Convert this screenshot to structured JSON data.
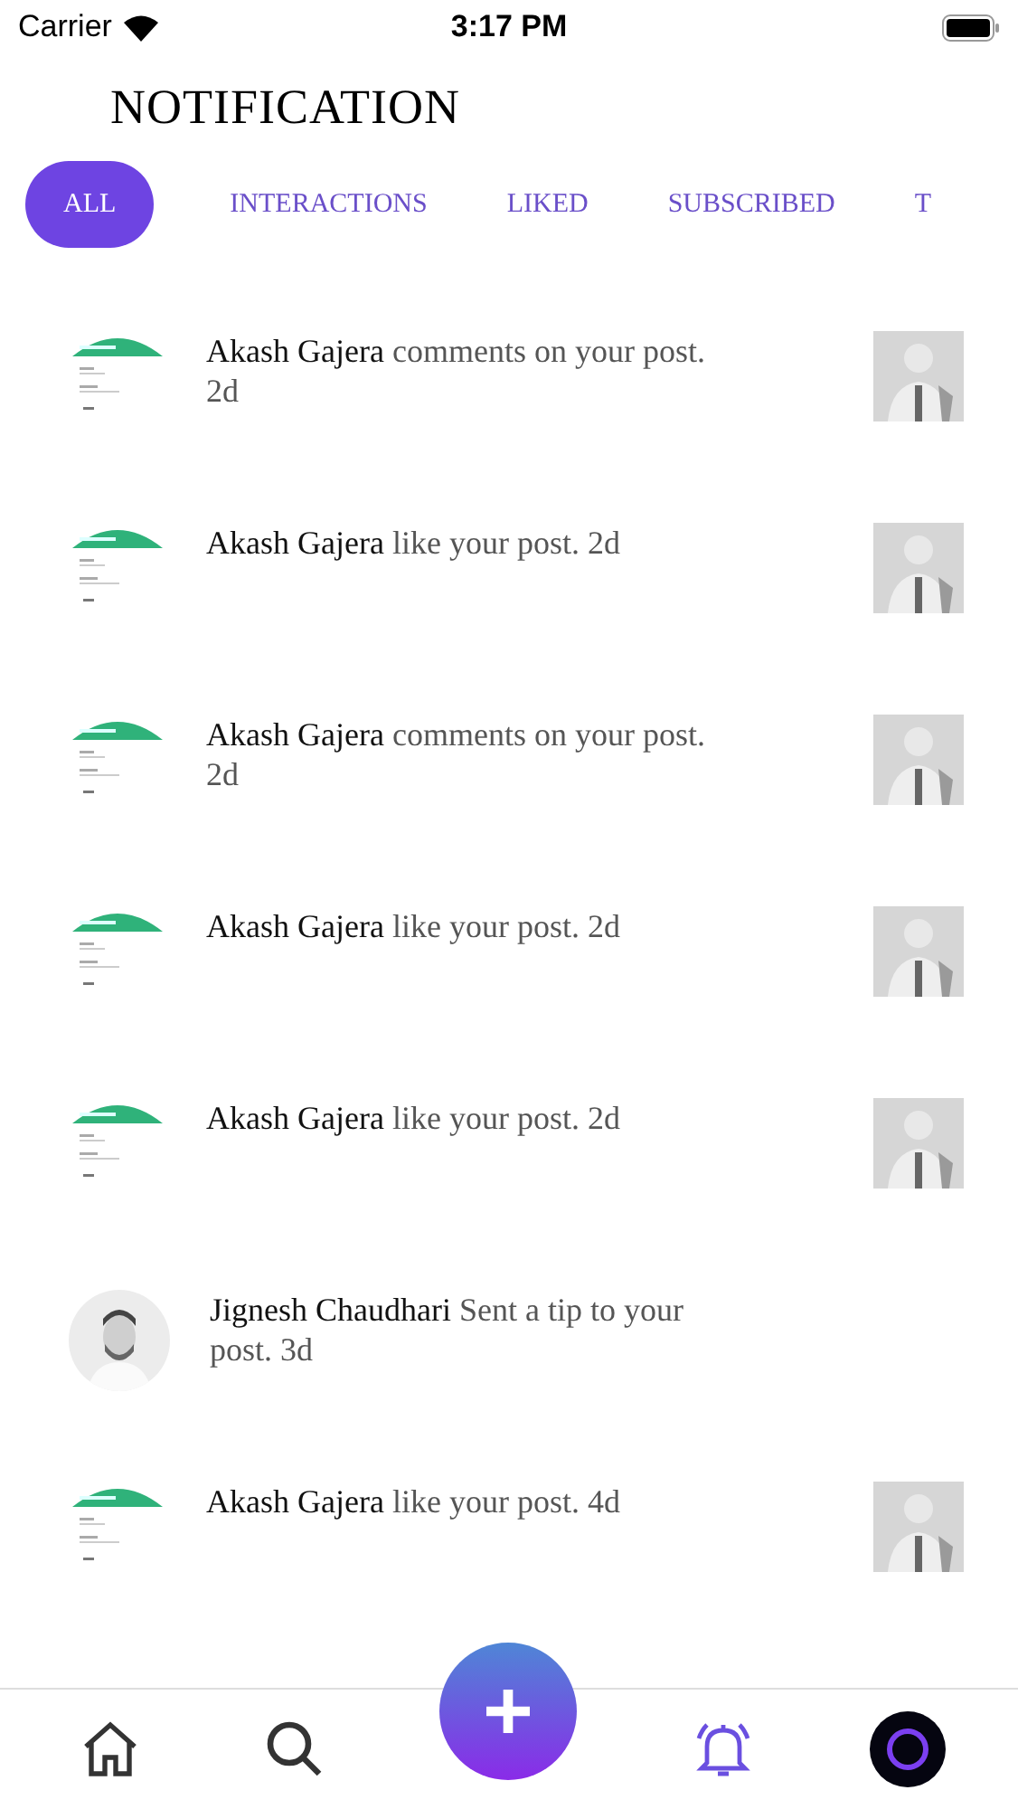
{
  "status_bar": {
    "carrier": "Carrier",
    "time": "3:17 PM"
  },
  "title": "NOTIFICATION",
  "tabs": [
    {
      "label": "ALL",
      "selected": true
    },
    {
      "label": "INTERACTIONS",
      "selected": false
    },
    {
      "label": "LIKED",
      "selected": false
    },
    {
      "label": "SUBSCRIBED",
      "selected": false
    },
    {
      "label": "T",
      "selected": false
    }
  ],
  "notifications": [
    {
      "kind": "post",
      "name": "Akash Gajera",
      "action": "comments on your post. 2d"
    },
    {
      "kind": "post",
      "name": "Akash Gajera",
      "action": "like your post. 2d"
    },
    {
      "kind": "post",
      "name": "Akash Gajera",
      "action": "comments on your post. 2d"
    },
    {
      "kind": "post",
      "name": "Akash Gajera",
      "action": "like your post. 2d"
    },
    {
      "kind": "post",
      "name": "Akash Gajera",
      "action": "like your post. 2d"
    },
    {
      "kind": "user",
      "name": "Jignesh Chaudhari",
      "action": "Sent a tip to your post. 3d"
    },
    {
      "kind": "post",
      "name": "Akash Gajera",
      "action": "like your post. 4d"
    }
  ],
  "bottom_nav": [
    {
      "kind": "home",
      "selected": false
    },
    {
      "kind": "search",
      "selected": false
    },
    {
      "kind": "add",
      "selected": false
    },
    {
      "kind": "bell",
      "selected": true
    },
    {
      "kind": "profile",
      "selected": false
    }
  ]
}
